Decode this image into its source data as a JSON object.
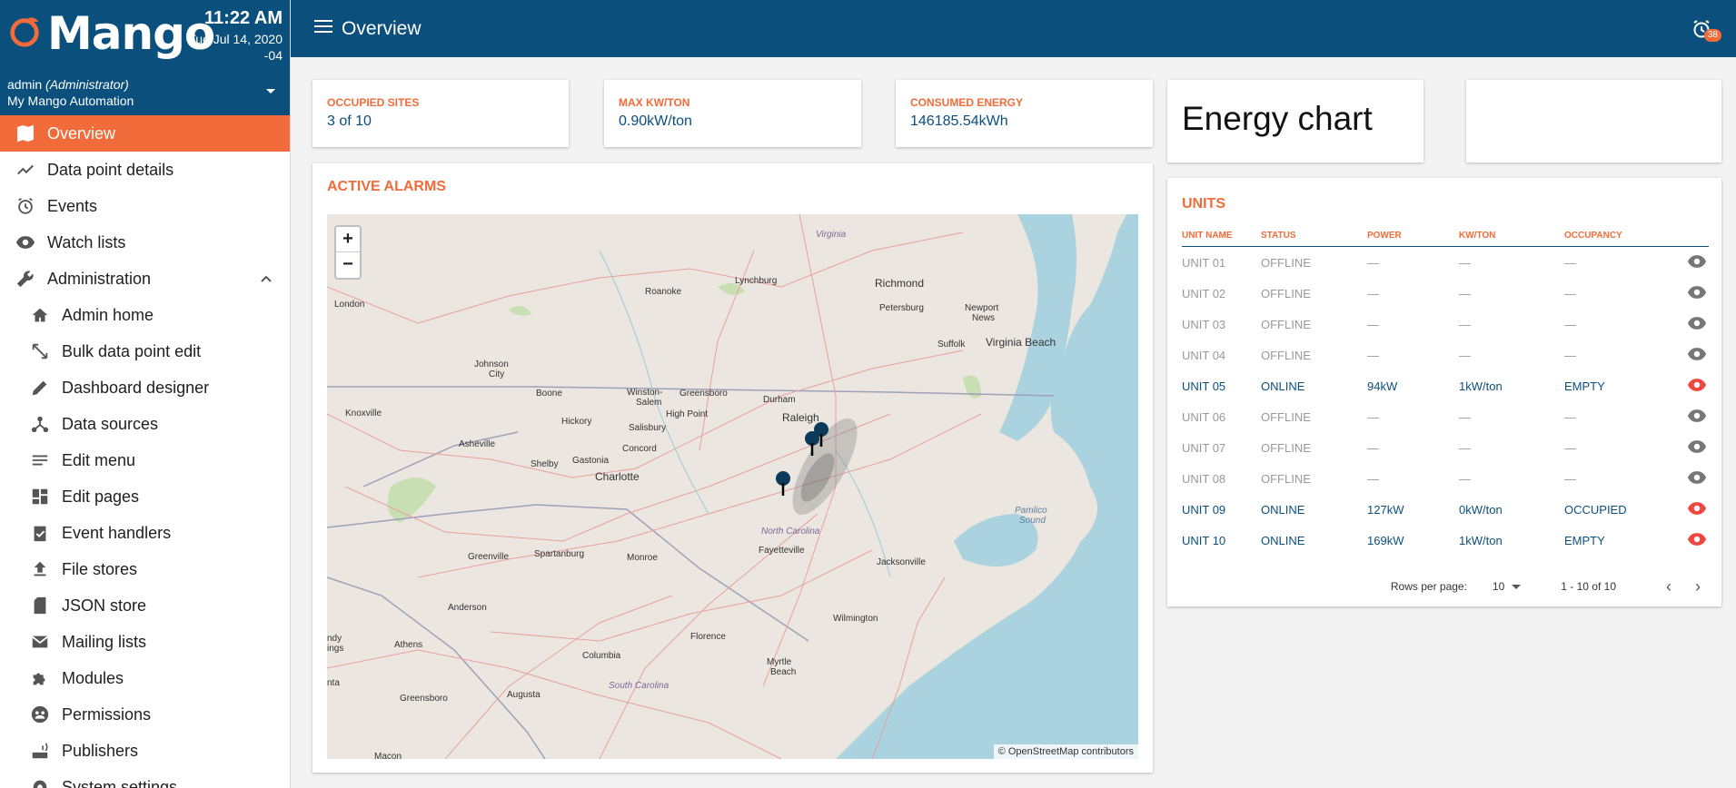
{
  "brand": {
    "name": "Mango",
    "time": "11:22 AM",
    "date": "Tue Jul 14, 2020",
    "tz": "-04"
  },
  "user": {
    "name": "admin",
    "role": "(Administrator)",
    "org": "My Mango Automation"
  },
  "nav": {
    "items": [
      {
        "label": "Overview",
        "icon": "map-icon",
        "active": true
      },
      {
        "label": "Data point details",
        "icon": "trend-icon"
      },
      {
        "label": "Events",
        "icon": "alarm-icon"
      },
      {
        "label": "Watch lists",
        "icon": "eye-icon"
      },
      {
        "label": "Administration",
        "icon": "wrench-icon",
        "expanded": true
      }
    ],
    "admin_items": [
      {
        "label": "Admin home",
        "icon": "home-icon"
      },
      {
        "label": "Bulk data point edit",
        "icon": "resize-icon"
      },
      {
        "label": "Dashboard designer",
        "icon": "pencil-icon"
      },
      {
        "label": "Data sources",
        "icon": "source-icon"
      },
      {
        "label": "Edit menu",
        "icon": "list-icon"
      },
      {
        "label": "Edit pages",
        "icon": "dashboard-icon"
      },
      {
        "label": "Event handlers",
        "icon": "clipboard-icon"
      },
      {
        "label": "File stores",
        "icon": "upload-icon"
      },
      {
        "label": "JSON store",
        "icon": "sd-card-icon"
      },
      {
        "label": "Mailing lists",
        "icon": "mail-icon"
      },
      {
        "label": "Modules",
        "icon": "puzzle-icon"
      },
      {
        "label": "Permissions",
        "icon": "group-icon"
      },
      {
        "label": "Publishers",
        "icon": "router-icon"
      },
      {
        "label": "System settings",
        "icon": "gear-icon"
      }
    ]
  },
  "topbar": {
    "title": "Overview",
    "alarm_count": "38"
  },
  "kpis": {
    "occupied": {
      "label": "OCCUPIED SITES",
      "value": "3 of 10"
    },
    "maxkw": {
      "label": "MAX KW/TON",
      "value": "0.90kW/ton"
    },
    "energy": {
      "label": "CONSUMED ENERGY",
      "value": "146185.54kWh"
    }
  },
  "energy_chart": {
    "title": "Energy chart"
  },
  "alarms": {
    "title": "ACTIVE ALARMS",
    "map": {
      "zoom_in": "+",
      "zoom_out": "−",
      "attribution": "© OpenStreetMap contributors",
      "labels": {
        "virginia": "Virginia",
        "lynchburg": "Lynchburg",
        "roanoke": "Roanoke",
        "richmond": "Richmond",
        "petersburg": "Petersburg",
        "newport": "Newport",
        "news": "News",
        "suffolk": "Suffolk",
        "vabeach": "Virginia Beach",
        "london": "London",
        "johnson": "Johnson",
        "city": "City",
        "boone": "Boone",
        "winston": "Winston-",
        "salem": "Salem",
        "greensboro": "Greensboro",
        "highpoint": "High Point",
        "durham": "Durham",
        "raleigh": "Raleigh",
        "knoxville": "Knoxville",
        "hickory": "Hickory",
        "salisbury": "Salisbury",
        "asheville": "Asheville",
        "concord": "Concord",
        "shelby": "Shelby",
        "gastonia": "Gastonia",
        "charlotte": "Charlotte",
        "northcarolina": "North Carolina",
        "fayetteville": "Fayetteville",
        "greenville": "Greenville",
        "spartanburg": "Spartanburg",
        "monroe": "Monroe",
        "jacksonville": "Jacksonville",
        "pamlico": "Pamlico",
        "sound": "Sound",
        "anderson": "Anderson",
        "wilmington": "Wilmington",
        "athens": "Athens",
        "florence": "Florence",
        "columbia": "Columbia",
        "southcarolina": "South Carolina",
        "myrtle": "Myrtle",
        "beach": "Beach",
        "augusta": "Augusta",
        "greensboroga": "Greensboro",
        "nta": "nta",
        "ndy": "ndy",
        "ings": "ings",
        "macon": "Macon"
      }
    }
  },
  "units": {
    "title": "UNITS",
    "columns": [
      "UNIT NAME",
      "STATUS",
      "POWER",
      "KW/TON",
      "OCCUPANCY"
    ],
    "rows": [
      {
        "name": "UNIT 01",
        "status": "OFFLINE",
        "power": "—",
        "kwton": "—",
        "occupancy": "—",
        "online": false
      },
      {
        "name": "UNIT 02",
        "status": "OFFLINE",
        "power": "—",
        "kwton": "—",
        "occupancy": "—",
        "online": false
      },
      {
        "name": "UNIT 03",
        "status": "OFFLINE",
        "power": "—",
        "kwton": "—",
        "occupancy": "—",
        "online": false
      },
      {
        "name": "UNIT 04",
        "status": "OFFLINE",
        "power": "—",
        "kwton": "—",
        "occupancy": "—",
        "online": false
      },
      {
        "name": "UNIT 05",
        "status": "ONLINE",
        "power": "94kW",
        "kwton": "1kW/ton",
        "occupancy": "EMPTY",
        "online": true
      },
      {
        "name": "UNIT 06",
        "status": "OFFLINE",
        "power": "—",
        "kwton": "—",
        "occupancy": "—",
        "online": false
      },
      {
        "name": "UNIT 07",
        "status": "OFFLINE",
        "power": "—",
        "kwton": "—",
        "occupancy": "—",
        "online": false
      },
      {
        "name": "UNIT 08",
        "status": "OFFLINE",
        "power": "—",
        "kwton": "—",
        "occupancy": "—",
        "online": false
      },
      {
        "name": "UNIT 09",
        "status": "ONLINE",
        "power": "127kW",
        "kwton": "0kW/ton",
        "occupancy": "OCCUPIED",
        "online": true
      },
      {
        "name": "UNIT 10",
        "status": "ONLINE",
        "power": "169kW",
        "kwton": "1kW/ton",
        "occupancy": "EMPTY",
        "online": true
      }
    ],
    "pager": {
      "rows_label": "Rows per page:",
      "rows_value": "10",
      "range": "1 - 10 of 10",
      "prev": "‹",
      "next": "›"
    }
  },
  "colors": {
    "primary": "#0b4f7d",
    "accent": "#f26b3a",
    "alert": "#f0463e"
  }
}
